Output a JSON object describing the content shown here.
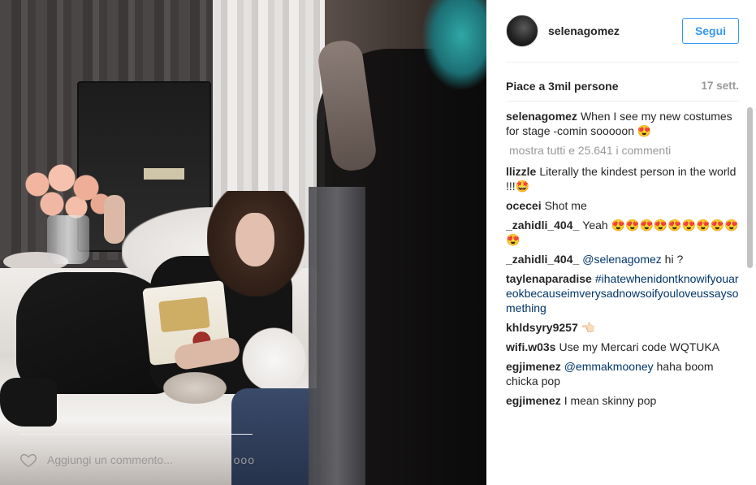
{
  "post": {
    "username": "selenagomez",
    "follow_label": "Segui",
    "likes": "Piace a 3mil persone",
    "time": "17 sett.",
    "caption": {
      "user": "selenagomez",
      "text": "When I see my new costumes for stage -comin sooooon 😍"
    },
    "load_more": "mostra tutti e 25.641 i commenti",
    "comments": [
      {
        "user": "llizzle",
        "text": "Literally the kindest person in the world !!!🤩"
      },
      {
        "user": "ocecei",
        "text": "Shot me"
      },
      {
        "user": "_zahidli_404_",
        "text": "Yeah 😍😍😍😍😍😍😍😍😍😍"
      },
      {
        "user": "_zahidli_404_",
        "mention": "@selenagomez",
        "text": "hi ?"
      },
      {
        "user": "taylenaparadise",
        "tag": "#ihatewhenidontknowifyouareokbecauseimverysadnowsoifyouloveussaysomething",
        "text": ""
      },
      {
        "user": "khldsyry9257",
        "text": "👈🏻"
      },
      {
        "user": "wifi.w03s",
        "text": "Use my Mercari code WQTUKA"
      },
      {
        "user": "egjimenez",
        "mention": "@emmakmooney",
        "text": "haha boom chicka pop"
      },
      {
        "user": "egjimenez",
        "text": "I mean skinny pop"
      }
    ],
    "comment_placeholder": "Aggiungi un commento...",
    "more_label": "ooo"
  },
  "colors": {
    "accent": "#3897f0",
    "link": "#003569",
    "muted": "#999999"
  },
  "icons": {
    "like": "heart-icon",
    "options": "more-options-icon"
  }
}
